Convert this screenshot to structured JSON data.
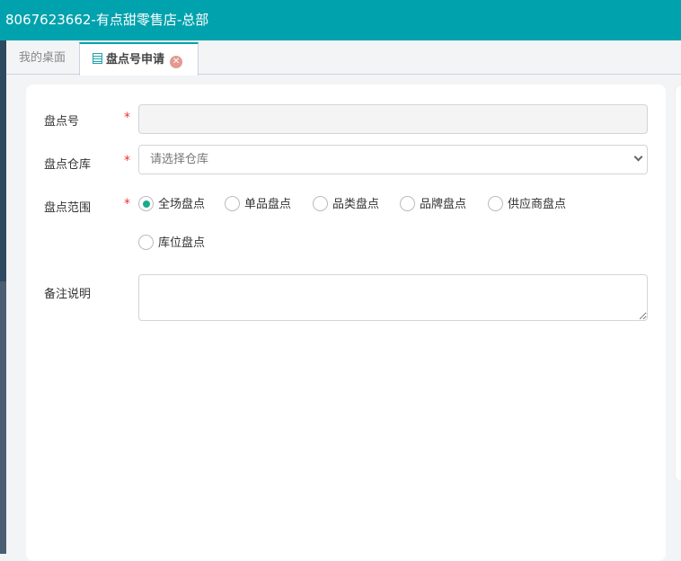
{
  "header": {
    "title": "8067623662-有点甜零售店-总部"
  },
  "tabs": [
    {
      "label": "我的桌面"
    },
    {
      "label": "盘点号申请"
    }
  ],
  "form": {
    "number": {
      "label": "盘点号",
      "value": ""
    },
    "warehouse": {
      "label": "盘点仓库",
      "placeholder": "请选择仓库"
    },
    "scope": {
      "label": "盘点范围",
      "options": [
        "全场盘点",
        "单品盘点",
        "品类盘点",
        "品牌盘点",
        "供应商盘点",
        "库位盘点"
      ],
      "selected": "全场盘点"
    },
    "remark": {
      "label": "备注说明",
      "value": ""
    },
    "required_mark": "*"
  },
  "colors": {
    "accent": "#00a2ad",
    "radio": "#1aab8b"
  }
}
